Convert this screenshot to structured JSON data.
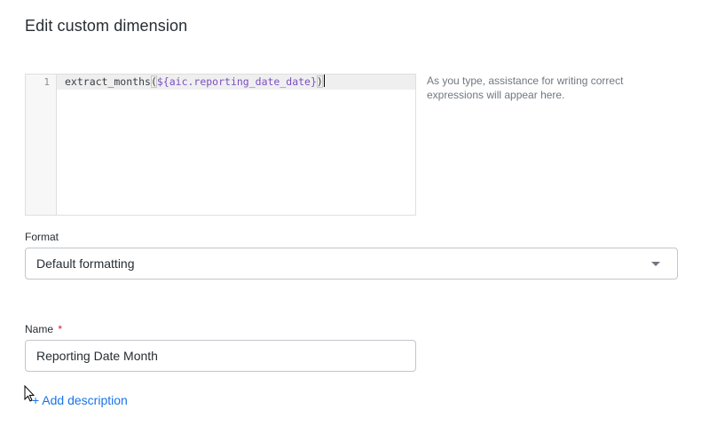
{
  "dialog": {
    "title": "Edit custom dimension"
  },
  "editor": {
    "line_number": "1",
    "code": {
      "function": "extract_months",
      "open_paren": "(",
      "field": "${aic.reporting_date_date}",
      "close_paren": ")"
    },
    "assist_text": "As you type, assistance for writing correct expressions will appear here."
  },
  "format": {
    "label": "Format",
    "selected": "Default formatting",
    "icon": "chevron-down-icon"
  },
  "name_field": {
    "label": "Name",
    "required_mark": "*",
    "value": "Reporting Date Month"
  },
  "add_description": {
    "label": "+ Add description"
  },
  "colors": {
    "accent_link": "#1a73e8",
    "code_field": "#7b4fc2",
    "required": "#cc1f36"
  }
}
